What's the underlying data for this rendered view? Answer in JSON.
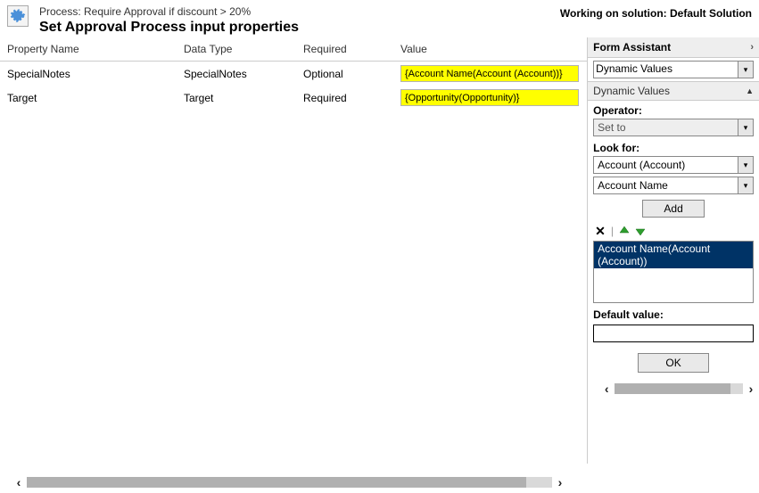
{
  "header": {
    "process_line": "Process: Require Approval if discount > 20%",
    "title": "Set Approval Process input properties",
    "working_on": "Working on solution: Default Solution"
  },
  "columns": {
    "property_name": "Property Name",
    "data_type": "Data Type",
    "required": "Required",
    "value": "Value"
  },
  "rows": [
    {
      "property_name": "SpecialNotes",
      "data_type": "SpecialNotes",
      "required": "Optional",
      "value": "{Account Name(Account (Account))}"
    },
    {
      "property_name": "Target",
      "data_type": "Target",
      "required": "Required",
      "value": "{Opportunity(Opportunity)}"
    }
  ],
  "assistant": {
    "header": "Form Assistant",
    "top_select": "Dynamic Values",
    "section_header": "Dynamic Values",
    "operator_label": "Operator:",
    "operator_value": "Set to",
    "lookfor_label": "Look for:",
    "lookfor_value1": "Account (Account)",
    "lookfor_value2": "Account Name",
    "add_label": "Add",
    "list_item": "Account Name(Account (Account))",
    "default_label": "Default value:",
    "default_value": "",
    "ok_label": "OK"
  }
}
